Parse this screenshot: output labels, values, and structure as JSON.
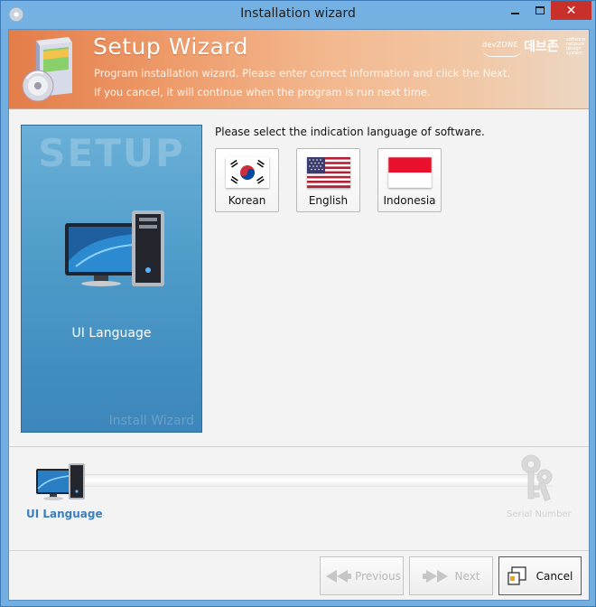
{
  "window": {
    "title": "Installation wizard",
    "close_glyph": "✕"
  },
  "banner": {
    "title": "Setup Wizard",
    "line1": "Program installation wizard. Please enter correct information and click the Next.",
    "line2": "If you cancel, it will continue when the program is run next time.",
    "brand_small": "devZONE",
    "brand_big": "데브존",
    "brand_tag": "software network design system"
  },
  "side_panel": {
    "watermark_title": "SETUP",
    "label": "UI Language",
    "watermark_footer": "Install Wizard"
  },
  "language": {
    "prompt": "Please select the indication language of software.",
    "options": [
      {
        "label": "Korean",
        "icon": "korea-flag-icon"
      },
      {
        "label": "English",
        "icon": "usa-flag-icon"
      },
      {
        "label": "Indonesia",
        "icon": "indonesia-flag-icon"
      }
    ]
  },
  "steps": {
    "current": "UI Language",
    "last": "Serial Number"
  },
  "buttons": {
    "previous": "Previous",
    "next": "Next",
    "cancel": "Cancel"
  },
  "colors": {
    "window_frame": "#74b0e2",
    "close_button": "#c7302b",
    "banner_start": "#e37d4a",
    "side_panel": "#4e9bc9",
    "active_step": "#3d7fbe",
    "disabled_text": "#b8b8b8"
  }
}
